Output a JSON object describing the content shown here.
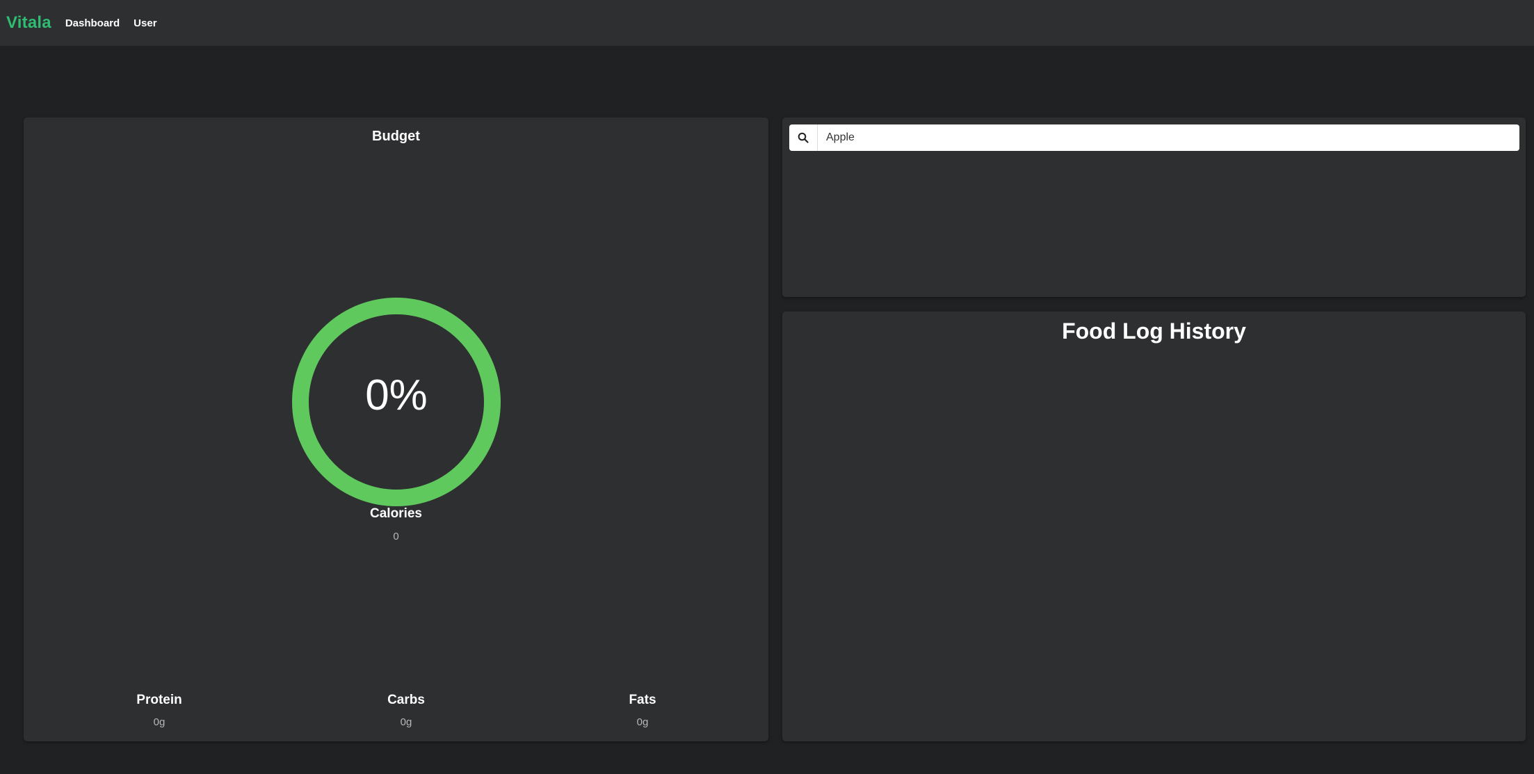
{
  "nav": {
    "brand": "Vitala",
    "brand_color": "#2ebd72",
    "links": [
      "Dashboard",
      "User"
    ]
  },
  "budget": {
    "title": "Budget",
    "percent_label": "0%",
    "ring_color": "#5fc95e",
    "calories_label": "Calories",
    "calories_value": "0",
    "macros": [
      {
        "label": "Protein",
        "value": "0g"
      },
      {
        "label": "Carbs",
        "value": "0g"
      },
      {
        "label": "Fats",
        "value": "0g"
      }
    ]
  },
  "search": {
    "value": "Apple",
    "icon": "search-icon"
  },
  "history": {
    "title": "Food Log History"
  }
}
